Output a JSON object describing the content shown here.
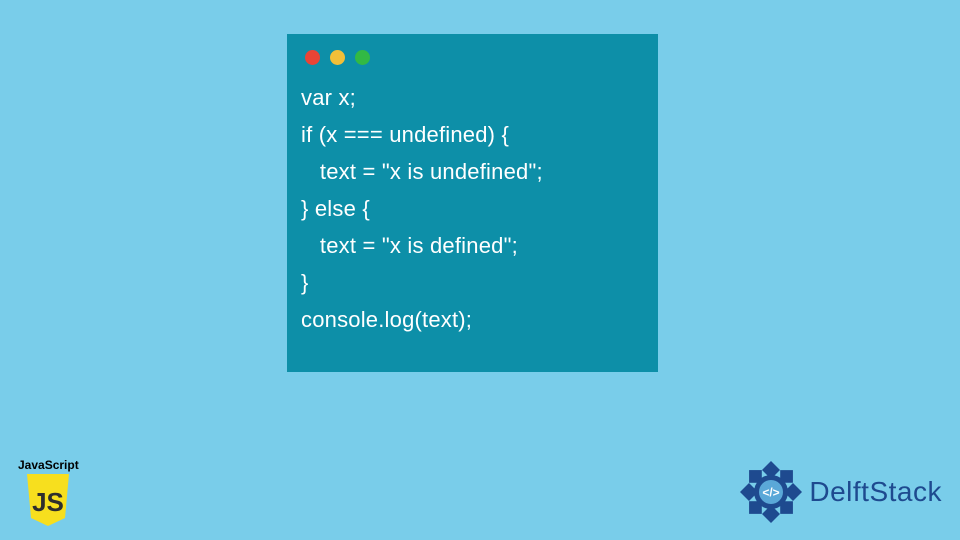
{
  "code_window": {
    "lines": [
      "var x;",
      "if (x === undefined) {",
      "   text = \"x is undefined\";",
      "} else {",
      "   text = \"x is defined\";",
      "}",
      "console.log(text);"
    ],
    "colors": {
      "bg": "#0d8fa8",
      "text": "#ffffff",
      "dot_red": "#e84435",
      "dot_yellow": "#f2bf38",
      "dot_green": "#32b944"
    }
  },
  "js_badge": {
    "label": "JavaScript",
    "shield_text": "JS",
    "shield_color": "#f7df1e"
  },
  "delftstack": {
    "brand_text": "DelftStack",
    "emblem_color": "#1e4a8f",
    "inner_symbol": "</>"
  },
  "page_bg": "#79cdea"
}
